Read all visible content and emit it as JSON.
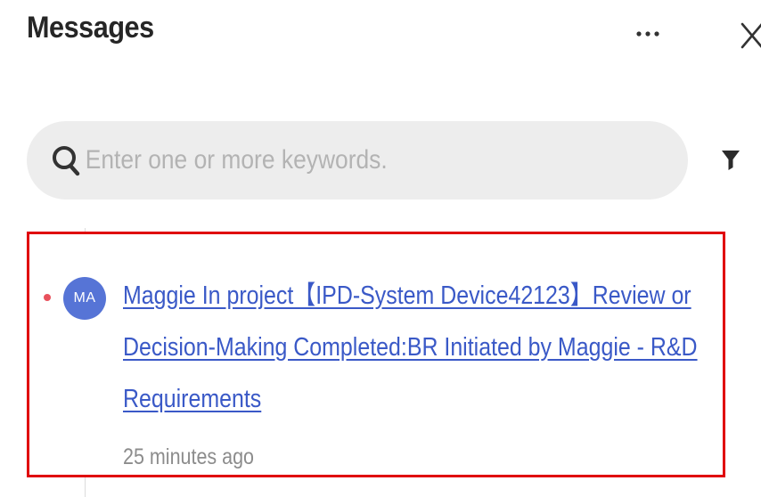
{
  "header": {
    "title": "Messages",
    "more_icon": "more-horizontal-icon",
    "close_icon": "close-icon"
  },
  "search": {
    "placeholder": "Enter one or more keywords.",
    "value": "",
    "icon": "search-icon"
  },
  "filter": {
    "icon": "filter-icon"
  },
  "messages": [
    {
      "avatar_initials": "MA",
      "unread": true,
      "text": "Maggie In project【IPD-System Device42123】Review or Decision-Making Completed:BR Initiated by Maggie - R&D Requirements",
      "time": "25 minutes ago"
    }
  ],
  "colors": {
    "accent_link": "#3a59c7",
    "avatar_bg": "#5674d6",
    "unread_dot": "#e8515c",
    "highlight_border": "#e0000c",
    "search_bg": "#ededed"
  }
}
